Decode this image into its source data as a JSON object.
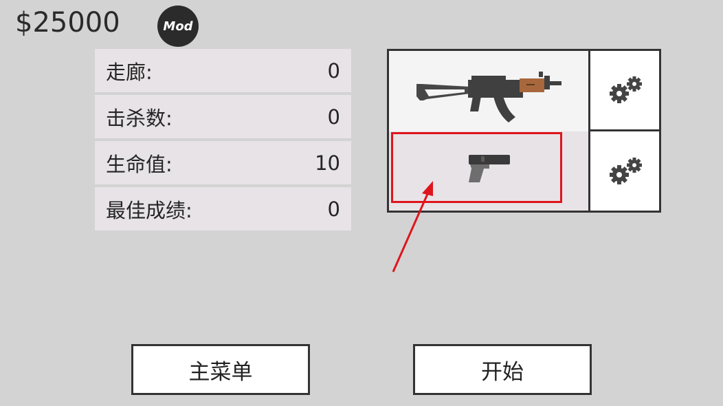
{
  "header": {
    "money": "$25000",
    "mod_badge": "Mod"
  },
  "stats": [
    {
      "label": "走廊:",
      "value": "0"
    },
    {
      "label": "击杀数:",
      "value": "0"
    },
    {
      "label": "生命值:",
      "value": "10"
    },
    {
      "label": "最佳成绩:",
      "value": "0"
    }
  ],
  "weapons": {
    "primary_icon": "assault-rifle-icon",
    "secondary_icon": "pistol-icon",
    "settings_icon": "gears-icon"
  },
  "buttons": {
    "main_menu": "主菜单",
    "start": "开始"
  },
  "colors": {
    "background": "#d3d3d3",
    "highlight": "#e0141c",
    "rifle_wood": "#a8673c"
  }
}
